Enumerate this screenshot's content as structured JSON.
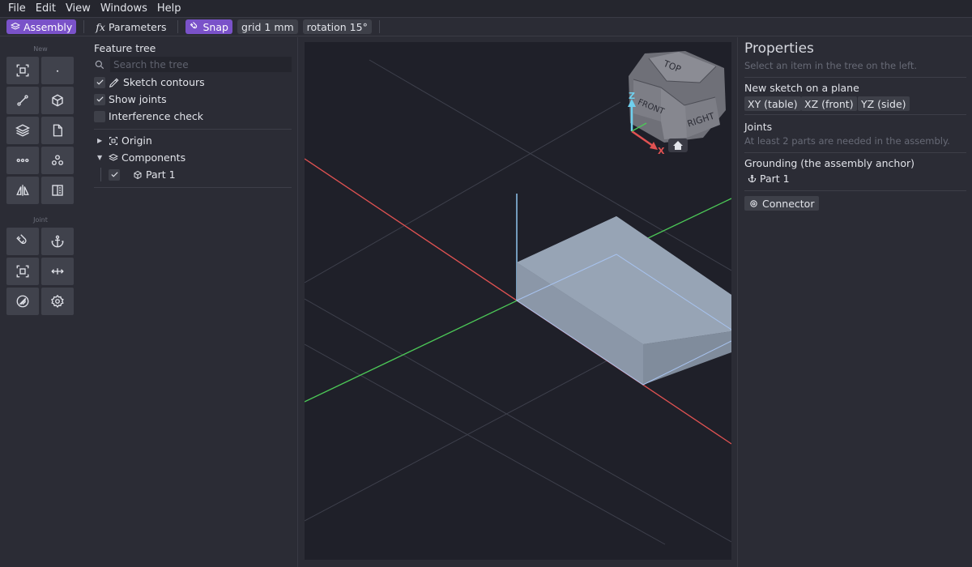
{
  "menu": [
    "File",
    "Edit",
    "View",
    "Windows",
    "Help"
  ],
  "toolbar": {
    "assembly": "Assembly",
    "parameters": "Parameters",
    "parameters_prefix": "fx",
    "snap": "Snap",
    "grid": "grid 1 mm",
    "rotation": "rotation 15°"
  },
  "tools": {
    "new_label": "New",
    "joint_label": "Joint",
    "new_icons": [
      "frame-select-icon",
      "point-icon",
      "line-icon",
      "cube-icon",
      "layers-icon",
      "document-icon",
      "pattern-icon",
      "components-icon",
      "mirror-icon",
      "panel-icon"
    ],
    "joint_icons": [
      "magnet-icon",
      "anchor-icon",
      "frame-select-icon",
      "move-horizontal-icon",
      "gauge-icon",
      "gear-icon"
    ]
  },
  "tree": {
    "title": "Feature tree",
    "search_placeholder": "Search the tree",
    "options": [
      {
        "label": "Sketch contours",
        "checked": true,
        "icon": "sketch-icon"
      },
      {
        "label": "Show joints",
        "checked": true
      },
      {
        "label": "Interference check",
        "checked": false
      }
    ],
    "origin": "Origin",
    "components": "Components",
    "part1": "Part 1"
  },
  "viewcube": {
    "top": "TOP",
    "front": "FRONT",
    "right": "RIGHT",
    "z": "Z",
    "x": "X"
  },
  "properties": {
    "title": "Properties",
    "subtitle": "Select an item in the tree on the left.",
    "sketch_heading": "New sketch on a plane",
    "planes": [
      "XY (table)",
      "XZ (front)",
      "YZ (side)"
    ],
    "joints_heading": "Joints",
    "joints_note": "At least 2 parts are needed in the assembly.",
    "grounding_heading": "Grounding (the assembly anchor)",
    "grounding_part": "Part 1",
    "connector": "Connector"
  },
  "colors": {
    "accent": "#7a52c9",
    "x_axis": "#e05252",
    "y_axis": "#4cc857",
    "z_axis": "#8fc4ee",
    "part": "#94a2b4"
  }
}
